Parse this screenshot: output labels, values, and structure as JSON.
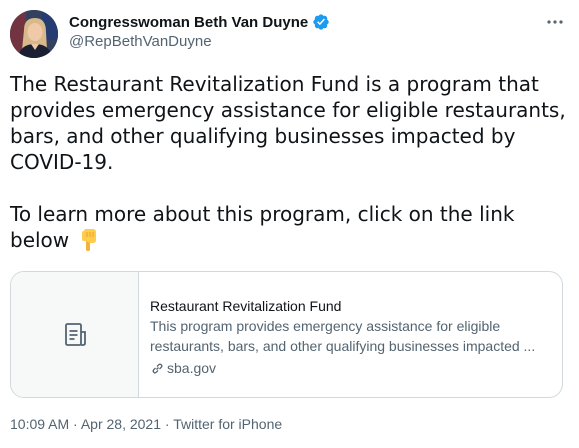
{
  "author": {
    "display_name": "Congresswoman Beth Van Duyne",
    "handle": "@RepBethVanDuyne",
    "verified": true
  },
  "tweet": {
    "paragraph1": "The Restaurant Revitalization Fund is a  program that provides emergency assistance for eligible restaurants, bars, and other qualifying businesses impacted by COVID-19.",
    "paragraph2": "To learn more about this program, click on the link below",
    "emoji": "backhand-index-pointing-down"
  },
  "link_card": {
    "title": "Restaurant Revitalization Fund",
    "description": "This program provides emergency assistance for eligible restaurants, bars, and other qualifying businesses impacted ...",
    "domain": "sba.gov"
  },
  "meta": {
    "time": "10:09 AM",
    "date": "Apr 28, 2021",
    "source": "Twitter for iPhone",
    "separator": " · "
  },
  "colors": {
    "text": "#0f1419",
    "secondary": "#536471",
    "border": "#cfd9de",
    "verified": "#1d9bf0"
  }
}
